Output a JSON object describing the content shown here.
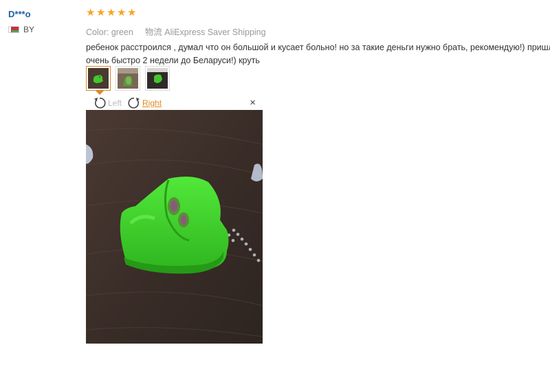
{
  "user": {
    "name": "D***o",
    "country": "BY"
  },
  "review": {
    "rating": 5,
    "color_label": "Color:",
    "color_value": "green",
    "shipping_label": "物流",
    "shipping_value": "AliExpress Saver Shipping",
    "line1": "ребенок расстроился , думал что он большой и кусает больно! но за такие деньги нужно брать, рекомендую!) пришло",
    "line2": "очень быстро 2 недели до Беларуси!) круть"
  },
  "thumbnails": [
    {
      "name": "photo-1",
      "active": true
    },
    {
      "name": "photo-2",
      "active": false
    },
    {
      "name": "photo-3",
      "active": false
    }
  ],
  "viewer": {
    "rotate_left_label": "Left",
    "rotate_right_label": "Right",
    "close_symbol": "×"
  },
  "colors": {
    "star": "#f5a623",
    "link": "#1d5fa8",
    "accent": "#e08a1e",
    "muted": "#999999"
  },
  "icons": [
    "star-icon",
    "rotate-left-icon",
    "rotate-right-icon",
    "close-icon",
    "flag-by-icon"
  ]
}
